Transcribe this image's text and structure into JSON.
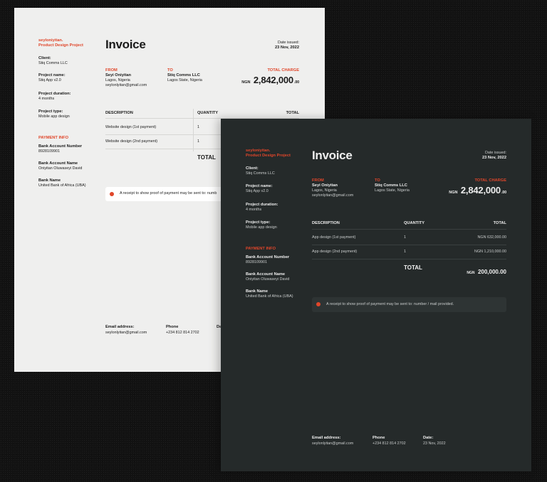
{
  "brand": {
    "name": "seyloniyitan.",
    "project": "Product Design Project"
  },
  "meta": {
    "client_label": "Client:",
    "client": "Stiq Comms LLC",
    "project_name_label": "Project name:",
    "project_duration_label": "Project duration:",
    "project_duration": "4 months",
    "project_type_label": "Project type:",
    "project_type": "Mobile app design"
  },
  "payment": {
    "heading": "PAYMENT INFO",
    "bank_account_number_label": "Bank Account Number",
    "bank_account_number": "8928109901",
    "bank_account_name_label": "Bank Account Name",
    "bank_account_name": "Oniyitan Oluwaseyi David",
    "bank_name_label": "Bank Name",
    "bank_name": "United Bank of Africa (UBA)"
  },
  "invoice": {
    "title": "Invoice",
    "date_label": "Date issued:",
    "date": "23 Nov, 2022",
    "from_label": "FROM",
    "from_name": "Seyi Oniyitan",
    "from_location": "Lagos, Nigeria",
    "from_email": "seylonlyitan@gmail.com",
    "to_label": "TO",
    "to_name": "Stiq Comms LLC",
    "to_location": "Lagos State, Nigeria",
    "total_charge_label": "TOTAL CHARGE",
    "currency": "NGN",
    "total_charge": "2,842,000",
    "total_charge_kobo": ".00"
  },
  "table": {
    "headers": {
      "description": "DESCRIPTION",
      "quantity": "QUANTITY",
      "total": "TOTAL"
    },
    "total_label": "TOTAL"
  },
  "light": {
    "project_name": "Stiq App v2.0",
    "rows": [
      {
        "description": "Website design (1st payment)",
        "quantity": "1"
      },
      {
        "description": "Website design (2nd payment)",
        "quantity": "1"
      }
    ],
    "note": "A receipt to show proof of payment may be sent to: numb"
  },
  "dark": {
    "project_name": "Stiq App v2.0",
    "rows": [
      {
        "description": "App design (1st payment)",
        "quantity": "1",
        "total": "NGN 632,000.00"
      },
      {
        "description": "App design (2nd payment)",
        "quantity": "1",
        "total": "NGN 1,210,000.00"
      }
    ],
    "total_currency": "NGN",
    "total_value": "200,000.00",
    "note": "A receipt to show proof of payment may be sent to: number / mail provided."
  },
  "footer": {
    "email_label": "Email address:",
    "email": "seylonlyitan@gmail.com",
    "phone_label": "Phone",
    "phone": "+234 812 814 2702",
    "date_label": "Date:",
    "date_partial": "Da",
    "date": "23 Nov, 2022"
  },
  "colors": {
    "accent": "#e0462a",
    "light_paper": "#efefee",
    "dark_paper": "#252a2a",
    "background": "#121212"
  }
}
